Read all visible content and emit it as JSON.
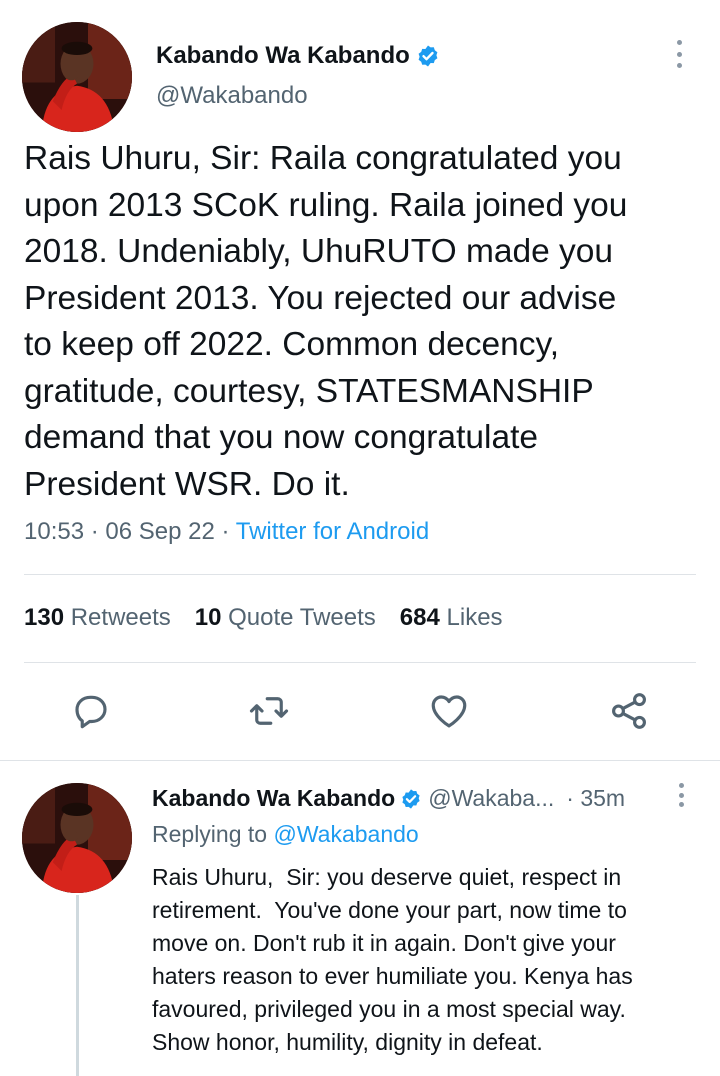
{
  "tweet": {
    "author": {
      "display_name": "Kabando Wa Kabando",
      "handle": "@Wakabando",
      "verified": true,
      "avatar_icon": "profile-photo"
    },
    "text": "Rais Uhuru, Sir: Raila congratulated you\nupon 2013 SCoK ruling. Raila joined you\n2018. Undeniably, UhuRUTO made you\nPresident 2013. You rejected our advise\nto keep off 2022. Common decency,\ngratitude, courtesy, STATESMANSHIP\ndemand that you now congratulate\nPresident WSR. Do it.",
    "time": "10:53",
    "date": "06 Sep 22",
    "source": "Twitter for Android",
    "stats": {
      "retweets_count": "130",
      "retweets_label": "Retweets",
      "quotes_count": "10",
      "quotes_label": "Quote Tweets",
      "likes_count": "684",
      "likes_label": "Likes"
    },
    "actions": [
      "reply-icon",
      "retweet-icon",
      "like-icon",
      "share-icon"
    ]
  },
  "reply": {
    "display_name": "Kabando Wa Kabando",
    "handle": "@Wakaba...",
    "time": "· 35m",
    "replying_prefix": "Replying to",
    "replying_to": "@Wakabando",
    "text": "Rais Uhuru,  Sir: you deserve quiet, respect in\nretirement.  You've done your part, now time to\nmove on. Don't rub it in again. Don't give your\nhaters reason to ever humiliate you. Kenya has\nfavoured, privileged you in a most special way.\nShow honor, humility, dignity in defeat."
  },
  "colors": {
    "accent": "#1d9bf0",
    "text": "#0f1419",
    "secondary": "#536471",
    "divider": "#dfe3e7"
  }
}
